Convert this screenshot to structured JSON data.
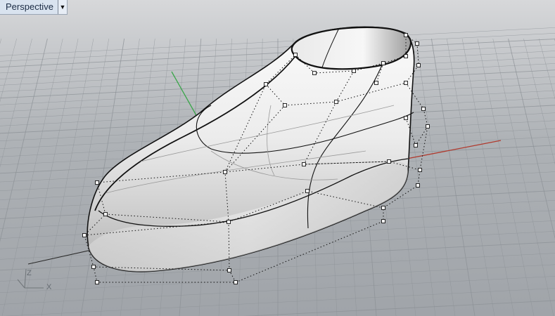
{
  "viewport": {
    "title": "Perspective",
    "menu_icon": "caret-down-icon"
  },
  "gizmo": {
    "z_label": "Z",
    "x_label": "X"
  },
  "colors": {
    "grid_line": "#8c9196",
    "x_axis": "#b03a2e",
    "y_axis": "#3aa64a",
    "surface_light": "#f4f4f4",
    "surface_shadow": "#b8b8b8",
    "edge": "#111111"
  },
  "scene": {
    "object": "shoe-last-surface",
    "control_points_visible": true
  }
}
